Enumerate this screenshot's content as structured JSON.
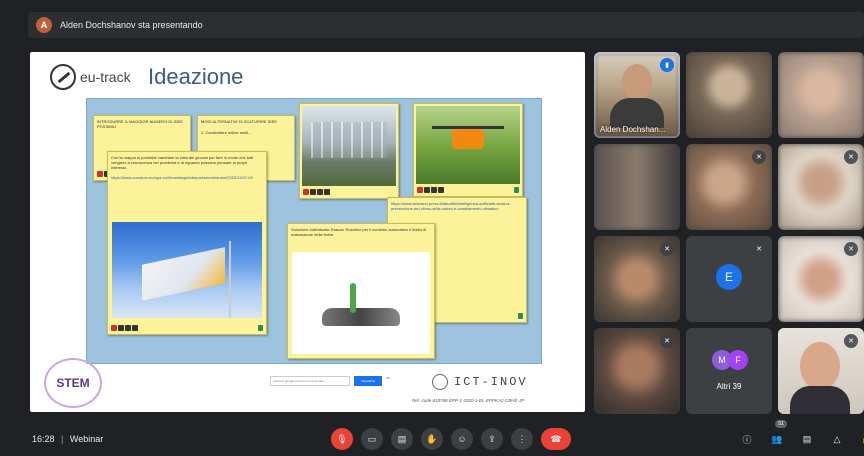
{
  "banner": {
    "avatar_letter": "A",
    "text": "Alden Dochshanov sta presentando"
  },
  "slide": {
    "logo_text": "eu-track",
    "title": "Ideazione",
    "notes": [
      {
        "text": "INTRODURRE IL MAGGIOR NUMERO DI IDEE POSSIBILI"
      },
      {
        "text": "MODI ALTERNATIVI DI SCATURIRE IDEE"
      },
      {
        "text": "1. Condividere online molti..."
      },
      {
        "text": "Con la mappa si potrebbe cambiare la rotta dei giovani per fare in modo che tutti vengano a conoscenza del problema e al riguardo possano pensare ai propri interessi.",
        "link": "https://www.corsdom.europa.eu/it/meetings/interpretazione/autori/2022/11/07-09"
      },
      {
        "text": "Soluzione individuata: Braccio Robotico per il controllo automatico il livello di maturazione della frutta"
      },
      {
        "link": "https://www.lamcano.press.it/attualita/intelligenza-artificiale-aiuta-la-prevenzione-del-clima-nella-natura-e-cambiamento-climatico"
      }
    ],
    "search_field_placeholder": "Inserisci google.com/url su cui postare",
    "search_button_label": "Visualizza",
    "search_extra": "Ok",
    "stem_label": "STEM",
    "ict_label": "ICT-INOV",
    "ref_code": "Ref. code 618768-EPP-1-2020-1-EL-EPPKA2-CBHE-JP"
  },
  "participants": [
    {
      "name": "Alden Dochshan..."
    },
    {
      "name": ""
    },
    {
      "name": ""
    },
    {
      "name": ""
    },
    {
      "name": ""
    },
    {
      "name": ""
    },
    {
      "name": ""
    },
    {
      "name": "",
      "avatar_letter": "E",
      "color": "#1a73e8"
    },
    {
      "name": ""
    },
    {
      "name": ""
    },
    {
      "name": "Altri 39",
      "avatar_letters": [
        "M",
        "F"
      ]
    },
    {
      "name": ""
    }
  ],
  "bottom_bar": {
    "time": "16:28",
    "separator": "|",
    "meeting_name": "Webinar",
    "participant_count": "51"
  },
  "colors": {
    "background": "#202124",
    "accent": "#1a73e8",
    "danger": "#ea4335"
  }
}
